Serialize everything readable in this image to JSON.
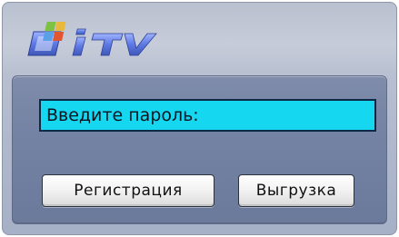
{
  "logo": {
    "text": "ITV"
  },
  "password": {
    "placeholder": "Введите пароль:"
  },
  "buttons": {
    "register_label": "Регистрация",
    "export_label": "Выгрузка"
  },
  "colors": {
    "window_bg": "#c6ccd9",
    "panel_bg": "#7482a3",
    "input_bg": "#15d7f0",
    "logo_blue": "#4f6fd6"
  }
}
